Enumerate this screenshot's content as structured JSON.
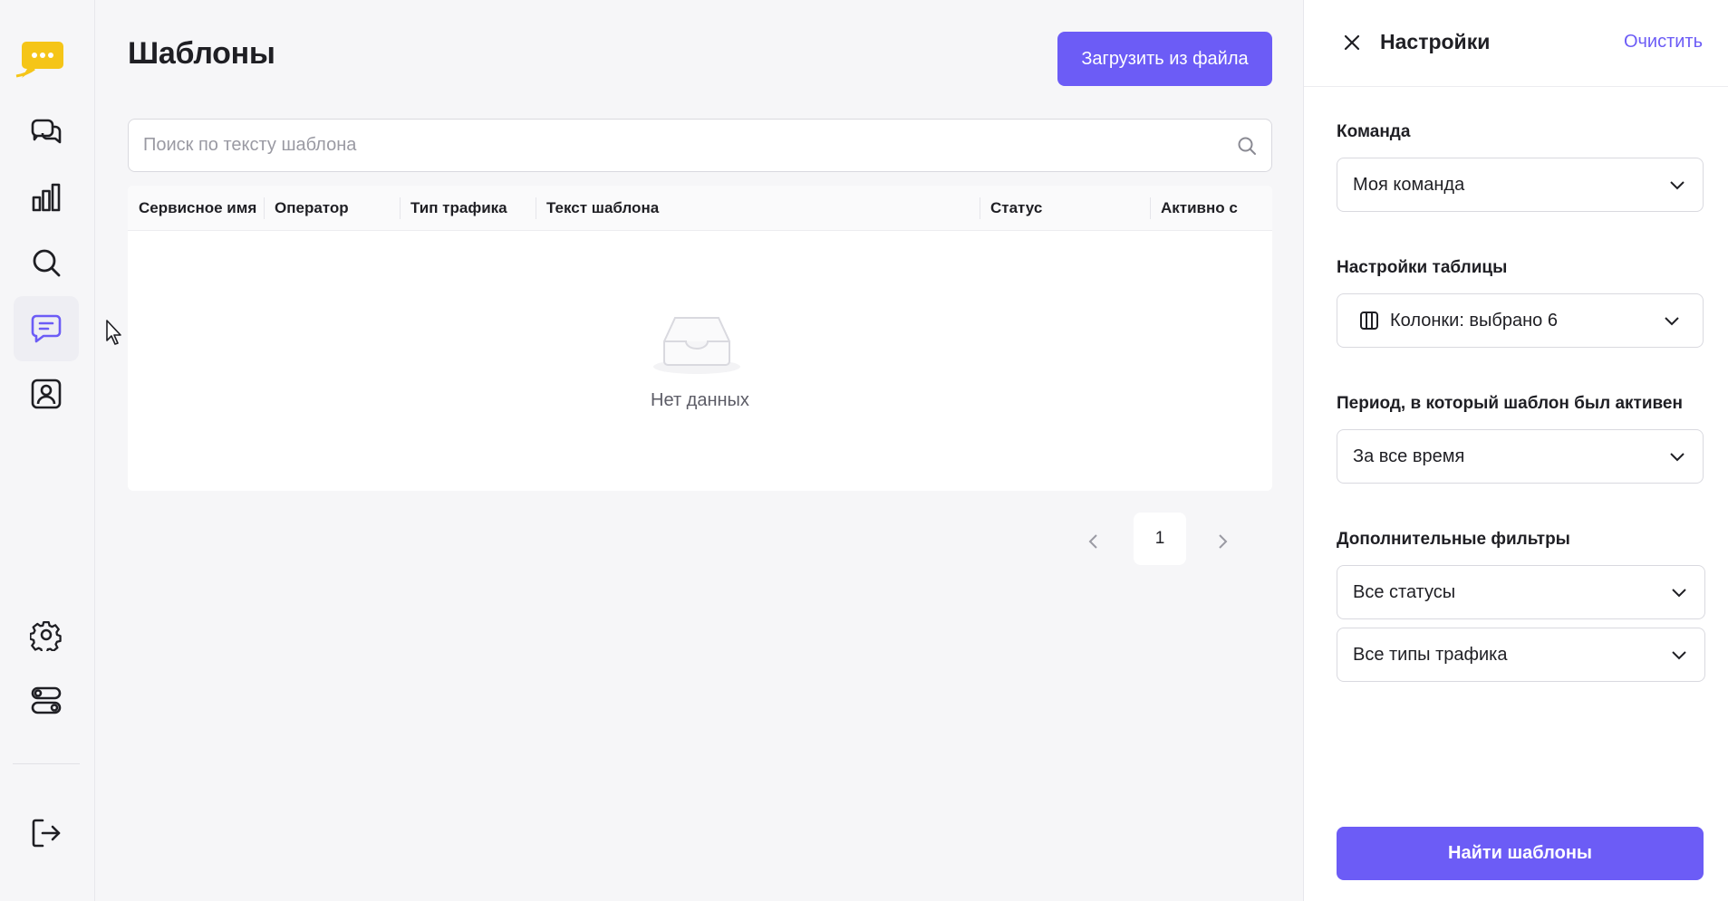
{
  "app": {
    "accent_color": "#6c5cf6",
    "logo_color": "#f5c518"
  },
  "sidebar": {
    "items": [
      {
        "icon": "chats-icon",
        "active": false
      },
      {
        "icon": "bar-chart-icon",
        "active": false
      },
      {
        "icon": "search-icon",
        "active": false
      },
      {
        "icon": "templates-message-icon",
        "active": true
      },
      {
        "icon": "contact-card-icon",
        "active": false
      }
    ],
    "bottom_items": [
      {
        "icon": "gear-icon"
      },
      {
        "icon": "toggles-icon"
      },
      {
        "icon": "logout-icon"
      }
    ]
  },
  "main": {
    "title": "Шаблоны",
    "upload_button": "Загрузить из файла",
    "search_placeholder": "Поиск по тексту шаблона",
    "table": {
      "columns": [
        "Сервисное имя",
        "Оператор",
        "Тип трафика",
        "Текст шаблона",
        "Статус",
        "Активно с"
      ],
      "empty_text": "Нет данных"
    },
    "pagination": {
      "current_page": "1"
    }
  },
  "panel": {
    "title": "Настройки",
    "clear_label": "Очистить",
    "team_label": "Команда",
    "team_value": "Моя команда",
    "table_settings_label": "Настройки таблицы",
    "columns_value": "Колонки: выбрано 6",
    "period_label": "Период, в который шаблон был активен",
    "period_value": "За все время",
    "extra_filters_label": "Дополнительные фильтры",
    "status_value": "Все статусы",
    "traffic_value": "Все типы трафика",
    "find_button": "Найти шаблоны"
  }
}
